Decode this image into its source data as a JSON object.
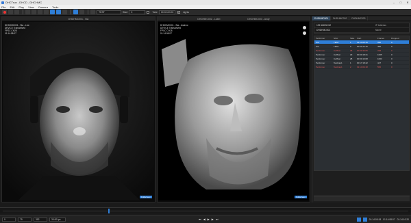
{
  "window": {
    "title": "DHCTrun - DHCD - DHCHMC",
    "controls": [
      "–",
      "□",
      "✕"
    ]
  },
  "menu": [
    "File",
    "Edit",
    "Play",
    "View",
    "Camera",
    "Tools"
  ],
  "toolbar": {
    "take_name": "TEST",
    "start_label": "Start",
    "start_value": "0",
    "take_label": "Take",
    "take_time": "00:00:00:00",
    "lights_label": "Lights",
    "lights_checked": "✓"
  },
  "viewport_left": {
    "header": "DHDHMC001 - Sta",
    "overlay": [
      "DHDHMC001 - Sta - Live",
      "DEVICE Transceived",
      "FPSC CH28",
      "01:14:08:07"
    ],
    "fullscreen": "Fullscreen"
  },
  "viewport_right": {
    "header": "DHDHMC002 - Label",
    "header2": "DHDHMC003 - Andy",
    "overlay": [
      "DHDHMC001 - Sta - Andrew",
      "DEVICE Transceived",
      "FPSC CH28",
      "01:14:08:07"
    ],
    "fullscreen": "Fullscreen"
  },
  "right_panel": {
    "tabs": [
      "DHDHMC001",
      "DHDHMC002",
      "DHDHMC003"
    ],
    "ip_rows": [
      {
        "value": "192.168.52.52",
        "key": "IP Address"
      },
      {
        "value": "DHDHMC001",
        "key": "Name"
      }
    ],
    "table": {
      "headers": [
        "Performer",
        "Shot",
        "Take",
        "Start",
        "Frames",
        "Dropped"
      ],
      "rows": [
        {
          "cells": [
            "Sta",
            "TEST",
            "1",
            "01:14:05:10",
            "396",
            "0"
          ],
          "style": "sel"
        },
        {
          "cells": [
            "Sta",
            "TEST",
            "0",
            "00:01:22:15",
            "486",
            "0"
          ],
          "style": ""
        },
        {
          "cells": [
            "Performer",
            "CalTest",
            "28",
            "00:00:30:05",
            "338",
            "0"
          ],
          "style": "red"
        },
        {
          "cells": [
            "Performer",
            "CalTest",
            "29",
            "00:00:18:21",
            "1005",
            "0"
          ],
          "style": ""
        },
        {
          "cells": [
            "Performer",
            "CalTest",
            "28",
            "00:00:16:08",
            "1003",
            "0"
          ],
          "style": ""
        },
        {
          "cells": [
            "Performer",
            "TestCap1",
            "1",
            "00:17:18:42",
            "447",
            "0"
          ],
          "style": ""
        },
        {
          "cells": [
            "Performer",
            "TestCap1",
            "2",
            "01:14:04:18",
            "556",
            "0"
          ],
          "style": "red"
        }
      ]
    }
  },
  "status": {
    "frame_start": "0",
    "frame_cur": "75",
    "frame_end": "352",
    "fps": "30.00 fps",
    "time_left": "01:14:05:18",
    "time_cur": "01:14:08:07",
    "time_right": "01:14:10:20"
  }
}
